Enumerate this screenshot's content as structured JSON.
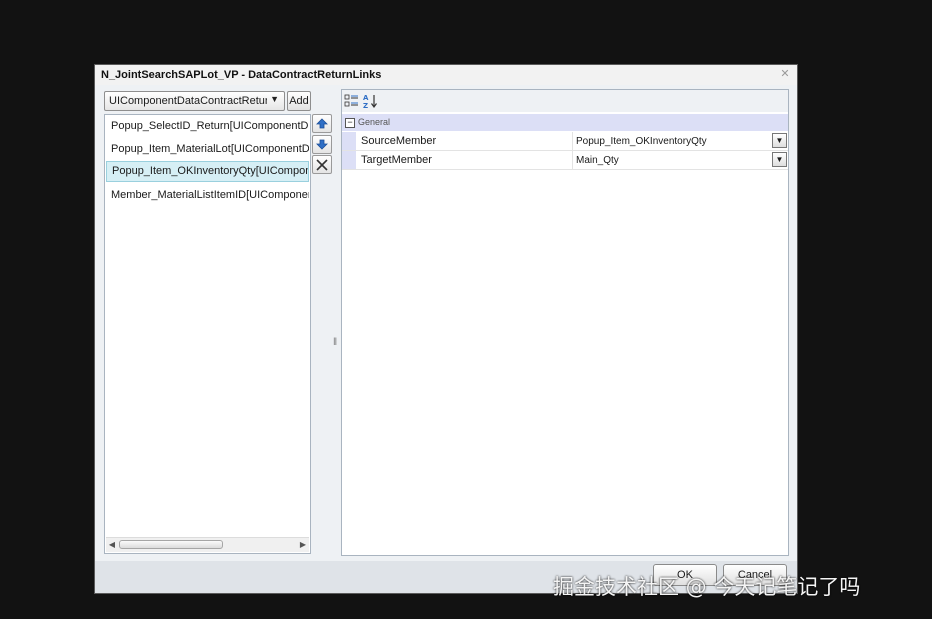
{
  "window": {
    "title": "N_JointSearchSAPLot_VP - DataContractReturnLinks",
    "close_icon": "close-icon"
  },
  "left": {
    "combo_value": "UIComponentDataContractReturn",
    "add_label": "Add",
    "items": [
      {
        "label": "Popup_SelectID_Return[UIComponentDataContractReturn]"
      },
      {
        "label": "Popup_Item_MaterialLot[UIComponentDataContractReturn]"
      },
      {
        "label": "Popup_Item_OKInventoryQty[UIComponentDataContractReturn]",
        "selected": true
      },
      {
        "label": "Member_MaterialListItemID[UIComponentDataContractReturn]"
      }
    ]
  },
  "side_buttons": {
    "up_icon": "arrow-up-icon",
    "down_icon": "arrow-down-icon",
    "delete_icon": "delete-x-icon"
  },
  "property_grid": {
    "category": "General",
    "rows": [
      {
        "name": "SourceMember",
        "value": "Popup_Item_OKInventoryQty"
      },
      {
        "name": "TargetMember",
        "value": "Main_Qty"
      }
    ]
  },
  "footer": {
    "ok_label": "OK",
    "cancel_label": "Cancel"
  },
  "watermark": "掘金技术社区 @ 今天记笔记了吗",
  "colors": {
    "background": "#121212",
    "selection": "#d6eff5",
    "category": "#dcdff6",
    "arrow_blue": "#2f6fc6"
  }
}
